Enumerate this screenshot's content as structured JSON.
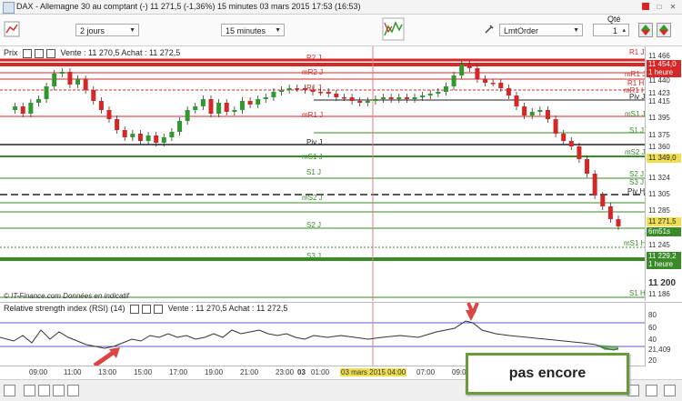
{
  "window": {
    "title": "DAX - Allemagne 30 au comptant (-)     11 271,5 (-1,36%)     15 minutes   03 mars 2015 17:53 (16:53)"
  },
  "toolbar": {
    "period": "2 jours",
    "interval": "15 minutes",
    "order_type": "LmtOrder",
    "qty_label": "Qté",
    "qty_value": "1"
  },
  "price_panel": {
    "label": "Prix",
    "header_text": "Vente : 11 270,5 Achat : 11 272,5",
    "copyright": "© IT-Finance.com  Données en indicatif"
  },
  "rsi_panel": {
    "label": "Relative strength index (RSI) (14)",
    "header_text": "Vente : 11 270,5 Achat : 11 272,5"
  },
  "price_axis": [
    "11 466",
    "11 454,0",
    "11 440",
    "11 423",
    "11 415",
    "11 395",
    "11 375",
    "11 360",
    "11 349,0",
    "11 324",
    "11 305",
    "11 285",
    "11 271,5",
    "11 245",
    "11 229,2",
    "11 200",
    "11 186"
  ],
  "badges": {
    "mr1_top": "11 454,0",
    "mr1_top_sub": "1 heure",
    "piv_level": "11 349,0",
    "last": "11 271,5",
    "countdown": "6m51s",
    "low": "11 229,2",
    "low_sub": "1 heure"
  },
  "levels_left": [
    "R2 J",
    "mR2 J",
    "R1 J",
    "mR1 J",
    "Piv J",
    "mS1 J",
    "S1 J",
    "mS2 J",
    "S2 J",
    "S3 J"
  ],
  "levels_right": [
    "R1 J",
    "mR1 J",
    "R1 H",
    "mR1 H",
    "Piv J",
    "mS1 J",
    "S1 J",
    "mS2 J",
    "S2 J",
    "Piv H",
    "S3 J",
    "mS1 H",
    "S1 H"
  ],
  "rsi_axis": [
    "80",
    "60",
    "40",
    "21,409",
    "20"
  ],
  "time_axis": [
    "09:00",
    "11:00",
    "13:00",
    "15:00",
    "17:00",
    "19:00",
    "21:00",
    "23:00",
    "03",
    "01:00",
    "03 mars 2015 04:00",
    "07:00",
    "09:00"
  ],
  "callout": "pas encore",
  "colors": {
    "up": "#2e9a2e",
    "down": "#d42828",
    "green_level": "#3a8a2a",
    "red_level": "#d62828",
    "rsi_band": "#5f5fcf"
  }
}
